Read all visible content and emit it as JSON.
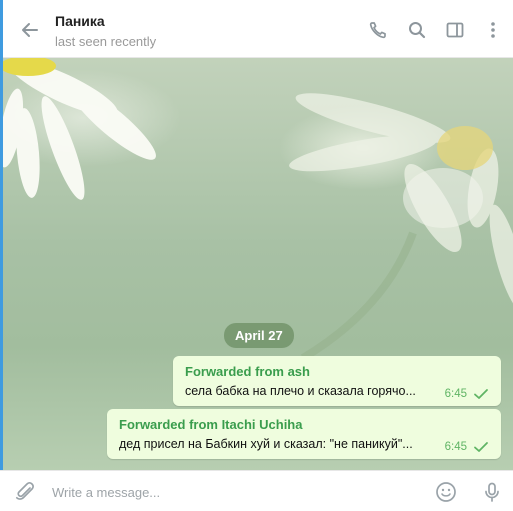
{
  "header": {
    "title": "Паника",
    "subtitle": "last seen recently"
  },
  "chat": {
    "date_label": "April 27",
    "messages": [
      {
        "forwarded_from": "Forwarded from ash",
        "text": "села бабка на плечо и сказала горячо...",
        "time": "6:45",
        "status": "sent"
      },
      {
        "forwarded_from": "Forwarded from Itachi Uchiha",
        "text": "дед присел на Бабкин хуй и сказал: \"не паникуй\"...",
        "time": "6:45",
        "status": "sent"
      }
    ]
  },
  "composer": {
    "placeholder": "Write a message...",
    "value": ""
  },
  "icons": {
    "back": "arrow-left-icon",
    "call": "phone-icon",
    "search": "search-icon",
    "sidebar": "sidebar-toggle-icon",
    "more": "more-vertical-icon",
    "attach": "paperclip-icon",
    "emoji": "emoji-icon",
    "voice": "microphone-icon",
    "read": "check-icon"
  },
  "colors": {
    "accent": "#3f9be0",
    "bubble_bg": "#effdde",
    "forward_name": "#3a9d4d",
    "time": "#5fb464",
    "icon_gray": "#8d969c"
  }
}
